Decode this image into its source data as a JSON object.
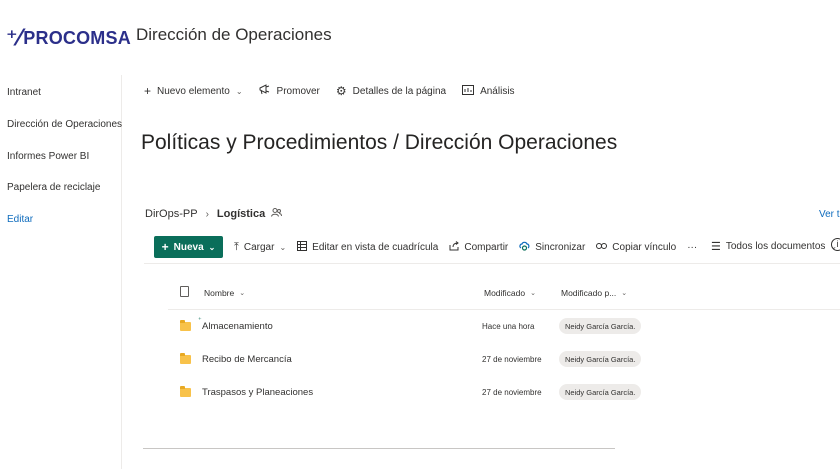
{
  "brand": {
    "logo_text": "PROCOMSA",
    "logo_mark": "⁺⁄",
    "color": "#2b2f8a"
  },
  "site": {
    "title": "Dirección de Operaciones"
  },
  "nav": {
    "items": [
      {
        "label": "Intranet"
      },
      {
        "label": "Dirección de Operaciones"
      },
      {
        "label": "Informes Power BI"
      },
      {
        "label": "Papelera de reciclaje"
      }
    ],
    "edit_label": "Editar"
  },
  "page_commands": {
    "new_item": "Nuevo elemento",
    "promote": "Promover",
    "page_details": "Detalles de la página",
    "analytics": "Análisis"
  },
  "page": {
    "heading": "Políticas y Procedimientos / Dirección Operaciones"
  },
  "library": {
    "breadcrumb_root": "DirOps-PP",
    "breadcrumb_current": "Logística",
    "see_all": "Ver to",
    "commands": {
      "new": "Nueva",
      "upload": "Cargar",
      "grid_edit": "Editar en vista de cuadrícula",
      "share": "Compartir",
      "sync": "Sincronizar",
      "copy_link": "Copiar vínculo",
      "more": "···",
      "view": "Todos los documentos"
    },
    "accent_color": "#0a6e5a",
    "columns": {
      "name": "Nombre",
      "modified": "Modificado",
      "modified_by": "Modificado p..."
    },
    "rows": [
      {
        "name": "Almacenamiento",
        "modified": "Hace una hora",
        "modified_by": "Neidy García García.",
        "is_new": true
      },
      {
        "name": "Recibo de Mercancía",
        "modified": "27 de noviembre",
        "modified_by": "Neidy García García.",
        "is_new": false
      },
      {
        "name": "Traspasos y Planeaciones",
        "modified": "27 de noviembre",
        "modified_by": "Neidy García García.",
        "is_new": false
      }
    ]
  },
  "icons": {
    "new_item": "plus-icon",
    "promote": "megaphone-icon",
    "page_details": "gear-icon",
    "analytics": "chart-icon",
    "upload": "upload-icon",
    "grid": "grid-icon",
    "share": "share-icon",
    "sync": "sync-icon",
    "link": "link-icon",
    "view": "list-icon",
    "info": "info-icon",
    "folder": "folder-icon",
    "file_type": "file-icon",
    "group": "group-icon"
  }
}
